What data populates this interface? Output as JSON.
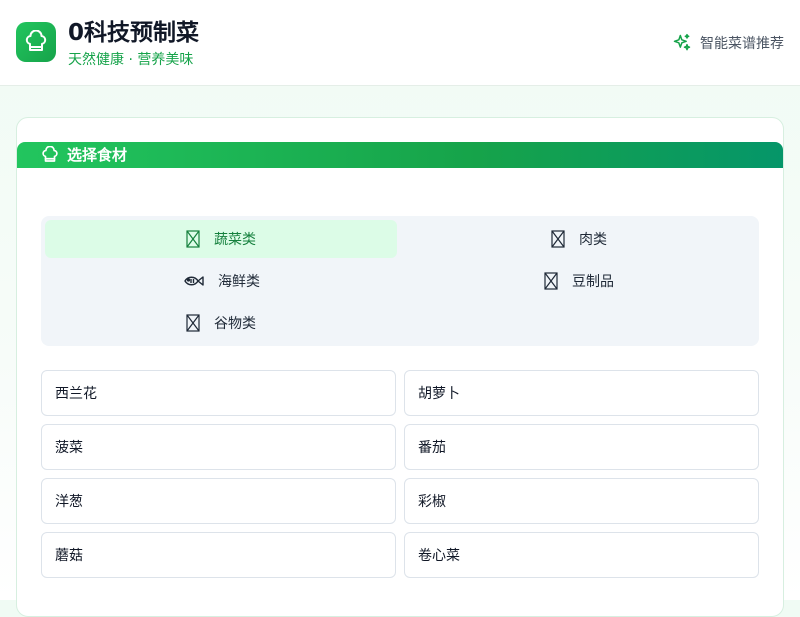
{
  "header": {
    "title": "0科技预制菜",
    "subtitle": "天然健康 · 营养美味",
    "recommend_label": "智能菜谱推荐",
    "logo_icon": "chef-hat-icon",
    "recommend_icon": "sparkles-icon"
  },
  "colors": {
    "accent": "#22c55e",
    "accent_dark": "#059669",
    "active_bg": "#dcfce7",
    "active_text": "#15803d"
  },
  "section": {
    "title": "选择食材",
    "icon": "chef-hat-icon"
  },
  "categories": [
    {
      "label": "蔬菜类",
      "icon": "missing-glyph-icon",
      "active": true
    },
    {
      "label": "肉类",
      "icon": "missing-glyph-icon",
      "active": false
    },
    {
      "label": "海鲜类",
      "icon": "fish-icon",
      "active": false
    },
    {
      "label": "豆制品",
      "icon": "missing-glyph-icon",
      "active": false
    },
    {
      "label": "谷物类",
      "icon": "missing-glyph-icon",
      "active": false
    }
  ],
  "ingredients": [
    "西兰花",
    "胡萝卜",
    "菠菜",
    "番茄",
    "洋葱",
    "彩椒",
    "蘑菇",
    "卷心菜"
  ]
}
